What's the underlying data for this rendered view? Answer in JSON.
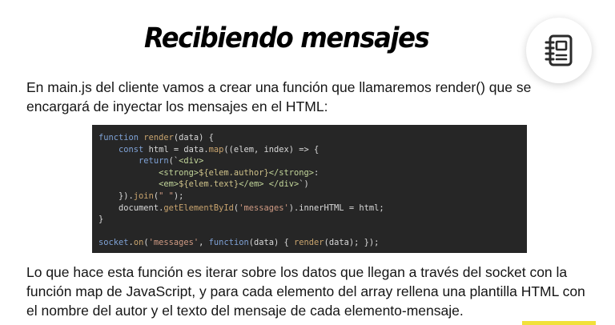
{
  "slide": {
    "title": "Recibiendo mensajes",
    "icon": "notebook-icon",
    "intro": "En main.js del cliente vamos a crear una función que llamaremos render() que se encargará de inyectar los mensajes en el HTML:",
    "explanation": "Lo que hace esta función es iterar sobre los datos que llegan a través del socket con la función map de JavaScript, y para cada elemento del array rellena una plantilla HTML con el nombre del autor y el texto del mensaje de cada elemento-mensaje."
  },
  "code": {
    "lines": [
      "function render(data) {",
      "    const html = data.map((elem, index) => {",
      "        return(`<div>",
      "            <strong>${elem.author}</strong>:",
      "            <em>${elem.text}</em> </div>`)",
      "    }).join(\" \");",
      "    document.getElementById('messages').innerHTML = html;",
      "}",
      "",
      "socket.on('messages', function(data) { render(data); });"
    ]
  }
}
